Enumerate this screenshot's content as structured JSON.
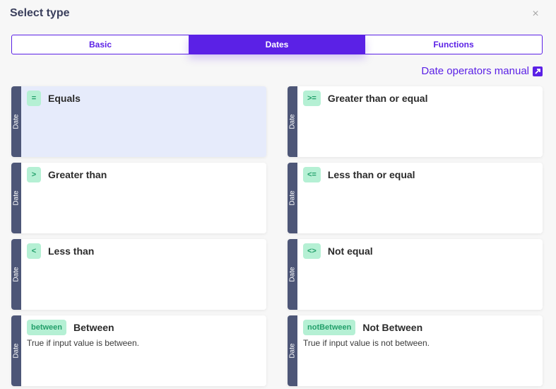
{
  "dialog": {
    "title": "Select type",
    "close_label": "×"
  },
  "tabs": [
    {
      "label": "Basic",
      "active": false
    },
    {
      "label": "Dates",
      "active": true
    },
    {
      "label": "Functions",
      "active": false
    }
  ],
  "manual_link": {
    "label": "Date operators manual",
    "icon": "external-link-icon"
  },
  "operators": [
    {
      "category": "Date",
      "symbol": "=",
      "name": "Equals",
      "description": "",
      "selected": true
    },
    {
      "category": "Date",
      "symbol": ">=",
      "name": "Greater than or equal",
      "description": ""
    },
    {
      "category": "Date",
      "symbol": ">",
      "name": "Greater than",
      "description": ""
    },
    {
      "category": "Date",
      "symbol": "<=",
      "name": "Less than or equal",
      "description": ""
    },
    {
      "category": "Date",
      "symbol": "<",
      "name": "Less than",
      "description": ""
    },
    {
      "category": "Date",
      "symbol": "<>",
      "name": "Not equal",
      "description": ""
    },
    {
      "category": "Date",
      "symbol": "between",
      "name": "Between",
      "description": "True if input value is between."
    },
    {
      "category": "Date",
      "symbol": "notBetween",
      "name": "Not Between",
      "description": "True if input value is not between."
    }
  ],
  "colors": {
    "accent": "#5b21e6",
    "side_bar": "#4d5677",
    "badge_bg": "#b5f0d4",
    "badge_text": "#23a06b",
    "selected_bg": "#e6ebfb"
  }
}
